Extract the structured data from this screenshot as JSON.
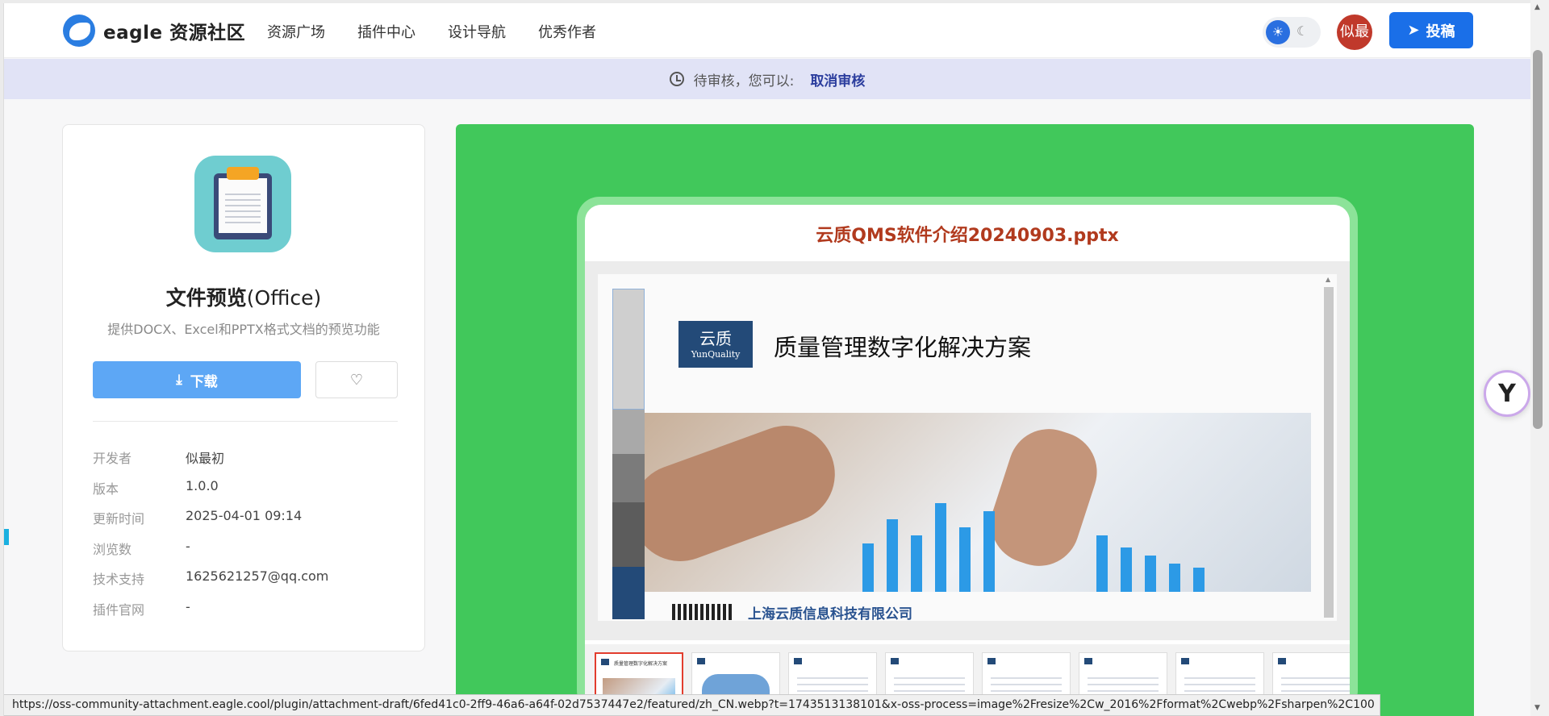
{
  "header": {
    "logo_text": "eagle 资源社区",
    "nav": [
      "资源广场",
      "插件中心",
      "设计导航",
      "优秀作者"
    ],
    "avatar_text": "似最",
    "submit_label": "投稿"
  },
  "banner": {
    "status_text": "待审核，您可以:",
    "cancel_label": "取消审核"
  },
  "plugin": {
    "title_bold": "文件预览",
    "title_rest": "(Office)",
    "description": "提供DOCX、Excel和PPTX格式文档的预览功能",
    "download_label": "下载",
    "meta": [
      {
        "key": "开发者",
        "value": "似最初"
      },
      {
        "key": "版本",
        "value": "1.0.0"
      },
      {
        "key": "更新时间",
        "value": "2025-04-01 09:14"
      },
      {
        "key": "浏览数",
        "value": "-"
      },
      {
        "key": "技术支持",
        "value": "1625621257@qq.com"
      },
      {
        "key": "插件官网",
        "value": "-"
      }
    ]
  },
  "preview": {
    "file_name": "云质QMS软件介绍20240903.pptx",
    "slide": {
      "logo_cn": "云质",
      "logo_en": "YunQuality",
      "heading": "质量管理数字化解决方案",
      "company": "上海云质信息科技有限公司"
    },
    "thumbnail_count": 8,
    "active_thumbnail": 1
  },
  "status_url": "https://oss-community-attachment.eagle.cool/plugin/attachment-draft/6fed41c0-2ff9-46a6-a64f-02d7537447e2/featured/zh_CN.webp?t=1743513138101&x-oss-process=image%2Fresize%2Cw_2016%2Fformat%2Cwebp%2Fsharpen%2C100",
  "colors": {
    "accent": "#1a6fe8",
    "banner_bg": "#e1e3f6",
    "preview_bg": "#41c85b",
    "file_title": "#b13a1e"
  }
}
